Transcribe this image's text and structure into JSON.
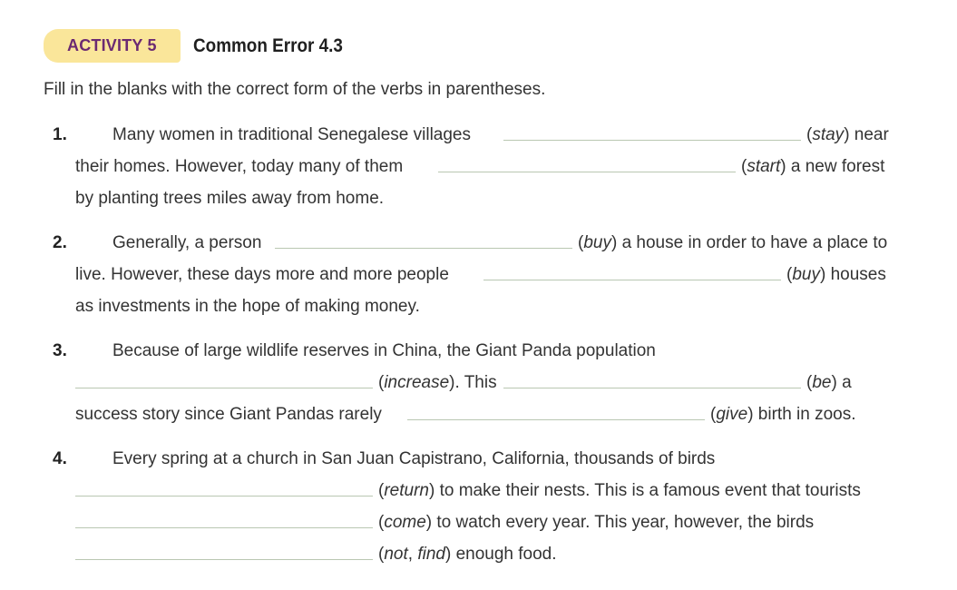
{
  "activity": {
    "badge": "ACTIVITY 5",
    "title": "Common Error 4.3",
    "badge_color": "#fae69a",
    "badge_text_color": "#6b2a72"
  },
  "instructions": "Fill in the blanks with the correct form of the verbs in parentheses.",
  "items": [
    {
      "number": "1.",
      "l1_text": "Many women in traditional Senegalese villages",
      "l1_verb": "stay",
      "l1_after": "near",
      "l2_text": "their homes. However, today many of them",
      "l2_verb": "start",
      "l2_after": "a new forest",
      "l3_text": "by planting trees miles away from home."
    },
    {
      "number": "2.",
      "l1_text": "Generally, a person",
      "l1_verb": "buy",
      "l1_after": "a house in order to have a place to",
      "l2_text": "live. However, these days more and more people",
      "l2_verb": "buy",
      "l2_after": "houses",
      "l3_text": "as investments in the hope of making money."
    },
    {
      "number": "3.",
      "l1_text": "Because of large wildlife reserves in China, the Giant Panda population",
      "l2_verb1": "increase",
      "l2_mid": "This",
      "l2_verb2": "be",
      "l2_after": "a",
      "l3_text": "success story since Giant Pandas rarely",
      "l3_verb": "give",
      "l3_after": "birth in zoos."
    },
    {
      "number": "4.",
      "l1_text": "Every spring at a church in San Juan Capistrano, California, thousands of birds",
      "l2_verb": "return",
      "l2_after": "to make their nests. This is a famous event that tourists",
      "l3_verb": "come",
      "l3_after": "to watch every year. This year, however, the birds",
      "l4_verb1": "not",
      "l4_verb2": "find",
      "l4_after": "enough food."
    }
  ]
}
